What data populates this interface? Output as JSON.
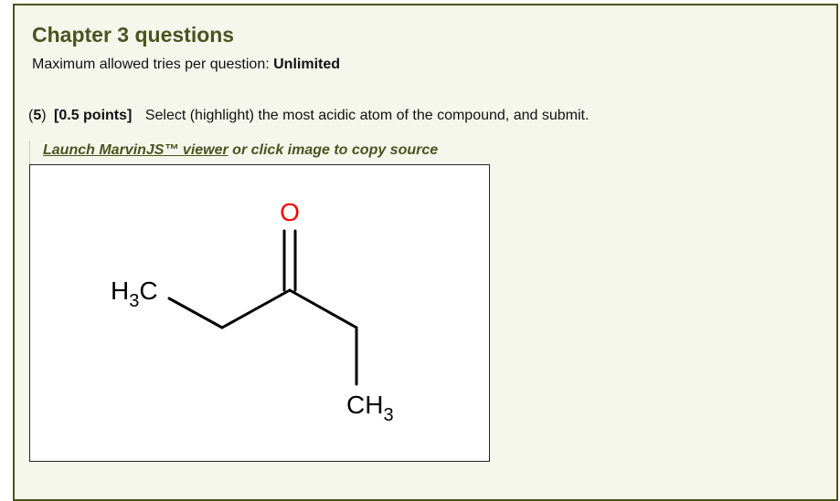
{
  "header": {
    "title": "Chapter 3 questions",
    "tries_label": "Maximum allowed tries per question:",
    "tries_value": "Unlimited"
  },
  "question": {
    "number_open": "(",
    "number": "5",
    "number_close": ")",
    "points": "[0.5 points]",
    "text": "Select (highlight) the most acidic atom of the compound, and submit."
  },
  "viewer": {
    "launch_link": "Launch MarvinJS™ viewer",
    "launch_suffix": " or click image to copy source"
  },
  "molecule": {
    "name_hidden": "",
    "atoms": {
      "oxygen": "O",
      "left_group_main": "H",
      "left_group_sub": "3",
      "left_group_tail": "C",
      "right_group_main": "CH",
      "right_group_sub": "3"
    },
    "colors": {
      "bond": "#000000",
      "oxygen": "#ff0000",
      "carbon_label": "#000000"
    }
  },
  "theme": {
    "accent": "#4b5320",
    "panel_bg": "#f5f7ec",
    "border": "#4b5320"
  }
}
